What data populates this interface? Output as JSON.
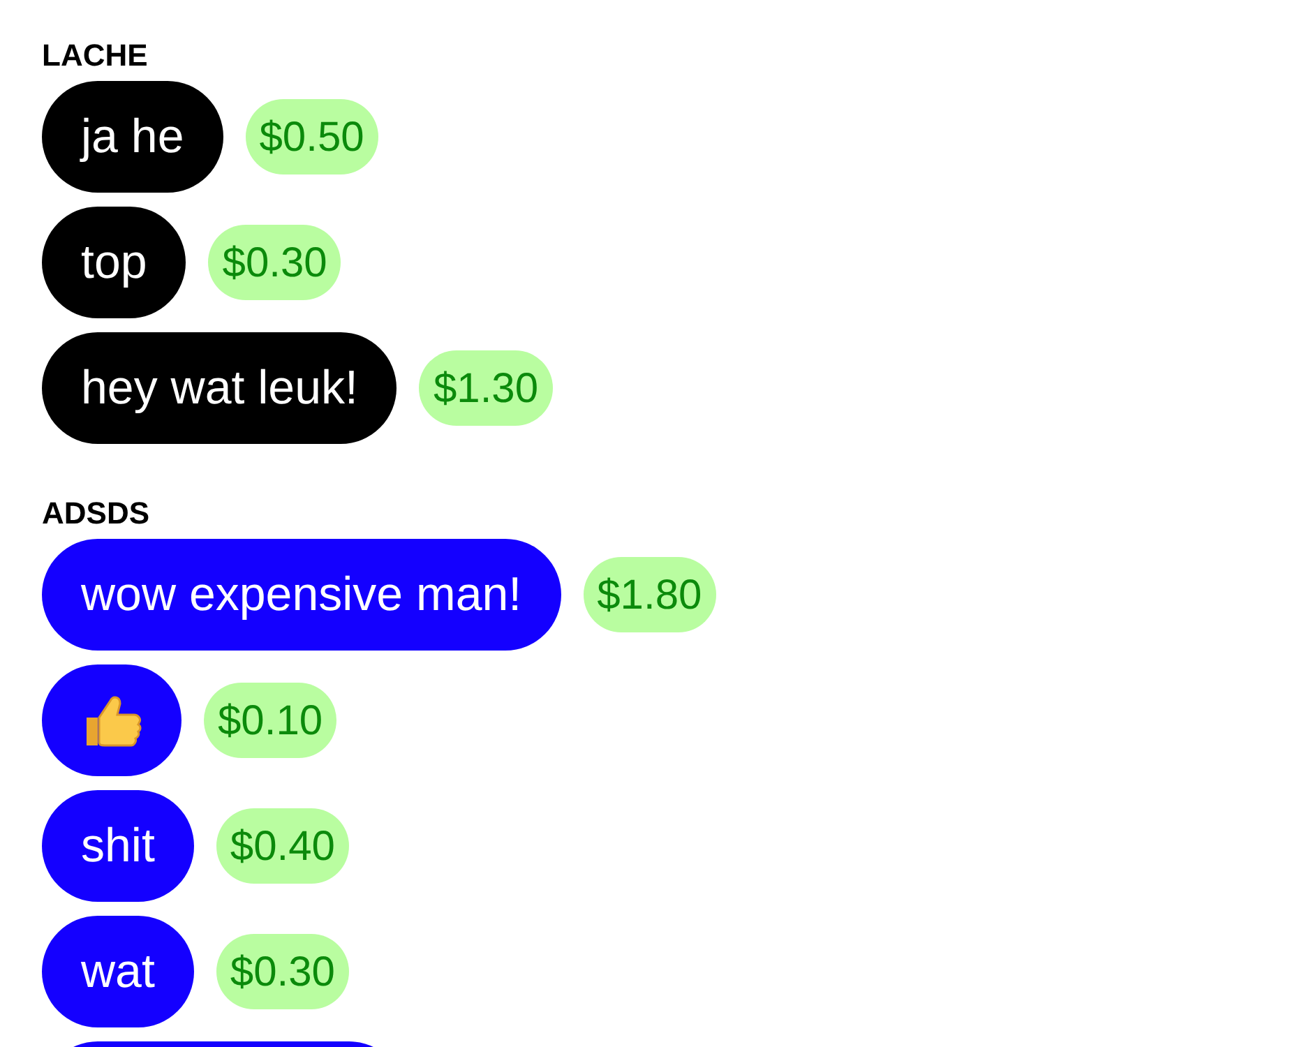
{
  "groups": [
    {
      "name": "LACHE",
      "color": "#000000",
      "messages": [
        {
          "kind": "text",
          "text": "ja he",
          "price": "$0.50"
        },
        {
          "kind": "text",
          "text": "top",
          "price": "$0.30"
        },
        {
          "kind": "text",
          "text": "hey wat leuk!",
          "price": "$1.30"
        }
      ]
    },
    {
      "name": "ADSDS",
      "color": "#1400ff",
      "messages": [
        {
          "kind": "text",
          "text": "wow expensive man!",
          "price": "$1.80"
        },
        {
          "kind": "thumbs-up",
          "price": "$0.10"
        },
        {
          "kind": "text",
          "text": "shit",
          "price": "$0.40"
        },
        {
          "kind": "text",
          "text": "wat",
          "price": "$0.30"
        },
        {
          "kind": "clipped"
        }
      ]
    }
  ]
}
